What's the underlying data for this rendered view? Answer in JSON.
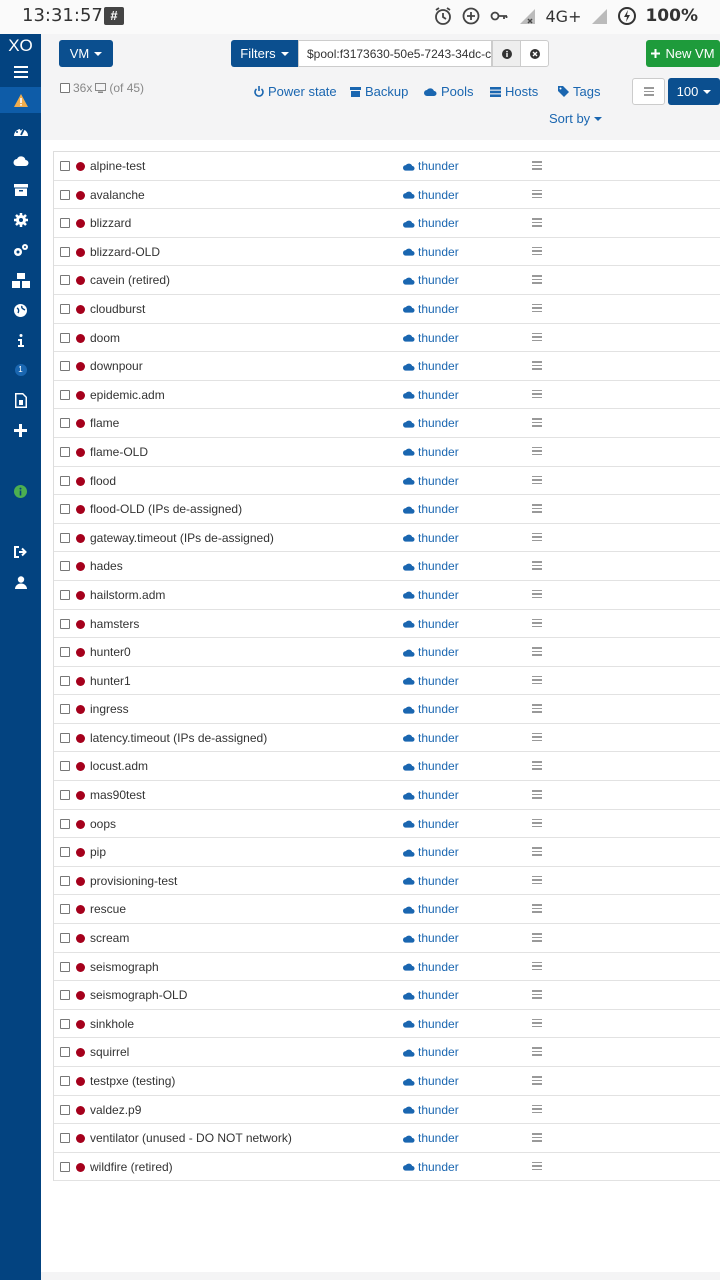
{
  "status_bar": {
    "time": "13:31:57",
    "notification_glyph": "#",
    "network": "4G+",
    "battery": "100%"
  },
  "sidebar": {
    "logo": "XO",
    "items": [
      {
        "icon": "menu-icon"
      },
      {
        "icon": "warning-icon"
      },
      {
        "icon": "dashboard-icon"
      },
      {
        "icon": "cloud-icon"
      },
      {
        "icon": "archive-icon"
      },
      {
        "icon": "cog-icon"
      },
      {
        "icon": "cogs-icon"
      },
      {
        "icon": "cubes-icon"
      },
      {
        "icon": "globe-icon"
      },
      {
        "icon": "info-icon"
      },
      {
        "icon": "tasks-badge",
        "badge": "1"
      },
      {
        "icon": "file-icon"
      },
      {
        "icon": "plus-icon"
      },
      {
        "icon": "info-circle-icon"
      },
      {
        "icon": "sign-out-icon"
      },
      {
        "icon": "user-icon"
      }
    ]
  },
  "toolbar": {
    "type_label": "VM",
    "filters_label": "Filters",
    "filter_value": "$pool:f3173630-50e5-7243-34dc-c0",
    "new_vm_label": "New VM",
    "count_label": "36x",
    "of_label": "(of 45)",
    "power_state_label": "Power state",
    "backup_label": "Backup",
    "pools_label": "Pools",
    "hosts_label": "Hosts",
    "tags_label": "Tags",
    "page_size": "100",
    "sort_label": "Sort by"
  },
  "colors": {
    "sidebar": "#034380",
    "primary": "#0b4f8f",
    "success": "#1e9b3b",
    "halted": "#a5001c",
    "link": "#1a66b0"
  },
  "vms": [
    {
      "name": "alpine-test",
      "pool": "thunder"
    },
    {
      "name": "avalanche",
      "pool": "thunder"
    },
    {
      "name": "blizzard",
      "pool": "thunder"
    },
    {
      "name": "blizzard-OLD",
      "pool": "thunder"
    },
    {
      "name": "cavein (retired)",
      "pool": "thunder"
    },
    {
      "name": "cloudburst",
      "pool": "thunder"
    },
    {
      "name": "doom",
      "pool": "thunder"
    },
    {
      "name": "downpour",
      "pool": "thunder"
    },
    {
      "name": "epidemic.adm",
      "pool": "thunder"
    },
    {
      "name": "flame",
      "pool": "thunder"
    },
    {
      "name": "flame-OLD",
      "pool": "thunder"
    },
    {
      "name": "flood",
      "pool": "thunder"
    },
    {
      "name": "flood-OLD (IPs de-assigned)",
      "pool": "thunder"
    },
    {
      "name": "gateway.timeout (IPs de-assigned)",
      "pool": "thunder"
    },
    {
      "name": "hades",
      "pool": "thunder"
    },
    {
      "name": "hailstorm.adm",
      "pool": "thunder"
    },
    {
      "name": "hamsters",
      "pool": "thunder"
    },
    {
      "name": "hunter0",
      "pool": "thunder"
    },
    {
      "name": "hunter1",
      "pool": "thunder"
    },
    {
      "name": "ingress",
      "pool": "thunder"
    },
    {
      "name": "latency.timeout (IPs de-assigned)",
      "pool": "thunder"
    },
    {
      "name": "locust.adm",
      "pool": "thunder"
    },
    {
      "name": "mas90test",
      "pool": "thunder"
    },
    {
      "name": "oops",
      "pool": "thunder"
    },
    {
      "name": "pip",
      "pool": "thunder"
    },
    {
      "name": "provisioning-test",
      "pool": "thunder"
    },
    {
      "name": "rescue",
      "pool": "thunder"
    },
    {
      "name": "scream",
      "pool": "thunder"
    },
    {
      "name": "seismograph",
      "pool": "thunder"
    },
    {
      "name": "seismograph-OLD",
      "pool": "thunder"
    },
    {
      "name": "sinkhole",
      "pool": "thunder"
    },
    {
      "name": "squirrel",
      "pool": "thunder"
    },
    {
      "name": "testpxe (testing)",
      "pool": "thunder"
    },
    {
      "name": "valdez.p9",
      "pool": "thunder"
    },
    {
      "name": "ventilator (unused - DO NOT network)",
      "pool": "thunder"
    },
    {
      "name": "wildfire (retired)",
      "pool": "thunder"
    }
  ]
}
